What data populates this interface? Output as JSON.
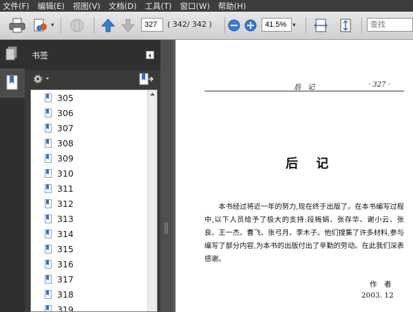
{
  "menu": [
    "文件(F)",
    "编辑(E)",
    "视图(V)",
    "文档(D)",
    "工具(T)",
    "窗口(W)",
    "帮助(H)"
  ],
  "toolbar": {
    "page_value": "327",
    "page_count": "( 342/ 342 )",
    "zoom_value": "41.5%",
    "search_placeholder": "查找"
  },
  "bookmarks": {
    "title": "书签",
    "items": [
      "305",
      "306",
      "307",
      "308",
      "309",
      "310",
      "311",
      "312",
      "313",
      "314",
      "315",
      "316",
      "317",
      "318",
      "319"
    ]
  },
  "document": {
    "running_title": "后　记",
    "page_number": "· 327 ·",
    "heading": "后 记",
    "paragraph": "　　本书经过将近一年的努力,现在终于出版了。在本书编写过程中,以下人员给予了极大的支持:段梅娟、张存华、谢小云、张良、王一杰、曹飞、张弓月、李木子。他们搜集了许多材料,参与编写了部分内容,为本书的出版付出了辛勤的劳动。在此我们深表感谢。",
    "signature": "作　者",
    "date": "2003. 12"
  },
  "colors": {
    "accent_blue": "#2f6fc2",
    "panel_dark": "#3a3a3a"
  }
}
